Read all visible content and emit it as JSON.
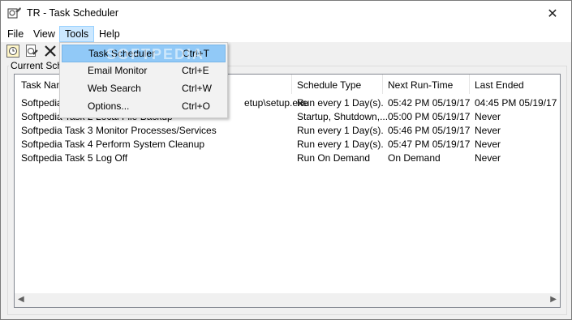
{
  "window": {
    "title": "TR - Task Scheduler"
  },
  "menubar": {
    "items": [
      "File",
      "View",
      "Tools",
      "Help"
    ]
  },
  "tools_menu": {
    "items": [
      {
        "label": "Task Scheduler",
        "shortcut": "Ctrl+T"
      },
      {
        "label": "Email Monitor",
        "shortcut": "Ctrl+E"
      },
      {
        "label": "Web Search",
        "shortcut": "Ctrl+W"
      },
      {
        "label": "Options...",
        "shortcut": "Ctrl+O"
      }
    ],
    "watermark": "SOFTPEDIA"
  },
  "group": {
    "label": "Current Sche"
  },
  "table": {
    "headers": [
      "Task Nam",
      "Schedule Type",
      "Next Run-Time",
      "Last Ended"
    ],
    "rows": [
      {
        "name": "Softpedia Task 1",
        "command": "etup\\setup.exe",
        "schedule": "Run every 1 Day(s).",
        "next": "05:42 PM 05/19/17",
        "last": "04:45 PM 05/19/17"
      },
      {
        "name": "Softpedia Task 2",
        "command": "Local File Backup",
        "schedule": "Startup, Shutdown,...",
        "next": "05:00 PM 05/19/17",
        "last": "Never"
      },
      {
        "name": "Softpedia Task 3",
        "command": "Monitor Processes/Services",
        "schedule": "Run every 1 Day(s).",
        "next": "05:46 PM 05/19/17",
        "last": "Never"
      },
      {
        "name": "Softpedia Task 4",
        "command": "Perform System Cleanup",
        "schedule": "Run every 1 Day(s).",
        "next": "05:47 PM 05/19/17",
        "last": "Never"
      },
      {
        "name": "Softpedia Task 5",
        "command": "Log Off",
        "schedule": "Run On Demand",
        "next": "On Demand",
        "last": "Never"
      }
    ]
  },
  "icons": [
    "app-icon",
    "new-task-icon",
    "edit-task-icon",
    "delete-task-icon",
    "close-icon",
    "scroll-left-icon",
    "scroll-right-icon"
  ]
}
